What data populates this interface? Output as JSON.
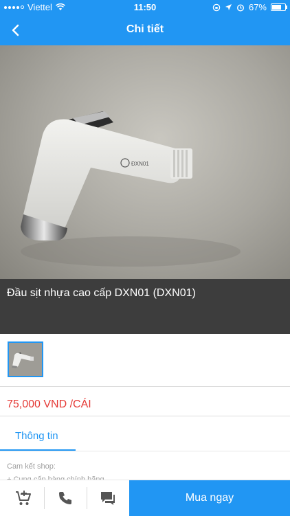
{
  "status_bar": {
    "carrier": "Viettel",
    "time": "11:50",
    "battery": "67%"
  },
  "nav": {
    "title": "Chi tiết"
  },
  "product": {
    "image_caption": "ĐXN01",
    "title": "Đầu sịt nhựa cao cấp DXN01 (DXN01)",
    "price": "75,000 VND /CÁI"
  },
  "tabs": [
    {
      "label": "Thông tin",
      "active": true
    }
  ],
  "details": {
    "commitment_label": "Cam kết shop:",
    "commitment_item": "+ Cung cấp hàng chính hãng"
  },
  "bottom_bar": {
    "buy_label": "Mua ngay",
    "icons": [
      "add-to-cart-icon",
      "phone-icon",
      "chat-icon"
    ]
  },
  "colors": {
    "primary": "#2196f3",
    "price": "#e53935",
    "title_band": "#3d3d3d"
  }
}
